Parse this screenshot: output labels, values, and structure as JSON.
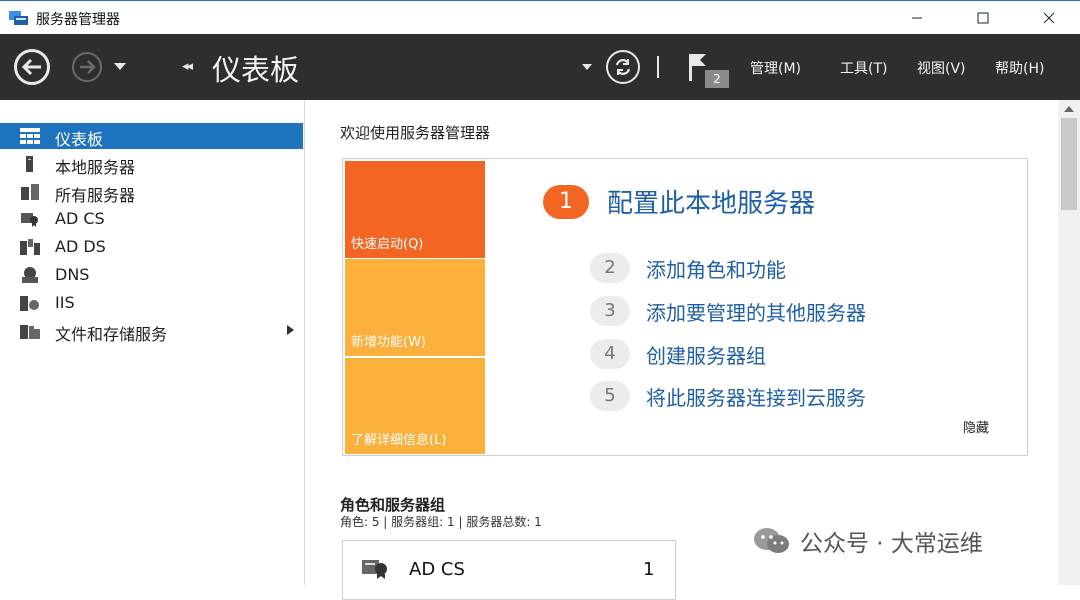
{
  "window": {
    "title": "服务器管理器"
  },
  "header": {
    "page_title": "仪表板",
    "notification_count": "2",
    "menus": [
      "管理(M)",
      "工具(T)",
      "视图(V)",
      "帮助(H)"
    ]
  },
  "sidebar": {
    "items": [
      {
        "label": "仪表板",
        "icon": "dashboard-icon",
        "active": true
      },
      {
        "label": "本地服务器",
        "icon": "server-icon"
      },
      {
        "label": "所有服务器",
        "icon": "servers-icon"
      },
      {
        "label": "AD CS",
        "icon": "certificate-icon"
      },
      {
        "label": "AD DS",
        "icon": "directory-icon"
      },
      {
        "label": "DNS",
        "icon": "dns-icon"
      },
      {
        "label": "IIS",
        "icon": "iis-icon"
      },
      {
        "label": "文件和存储服务",
        "icon": "storage-icon",
        "has_submenu": true
      }
    ]
  },
  "welcome": {
    "title": "欢迎使用服务器管理器",
    "tiles": [
      "快速启动(Q)",
      "新增功能(W)",
      "了解详细信息(L)"
    ],
    "steps": [
      {
        "num": "1",
        "label": "配置此本地服务器"
      },
      {
        "num": "2",
        "label": "添加角色和功能"
      },
      {
        "num": "3",
        "label": "添加要管理的其他服务器"
      },
      {
        "num": "4",
        "label": "创建服务器组"
      },
      {
        "num": "5",
        "label": "将此服务器连接到云服务"
      }
    ],
    "hide_label": "隐藏"
  },
  "roles": {
    "title": "角色和服务器组",
    "summary": "角色: 5 | 服务器组: 1 | 服务器总数: 1",
    "cards": [
      {
        "name": "AD CS",
        "count": "1"
      }
    ]
  },
  "watermark": {
    "text": "公众号 · 大常运维"
  },
  "colors": {
    "header_bg": "#2e2e2e",
    "accent": "#1e73be",
    "orange": "#f26522",
    "amber": "#fbb03b",
    "link": "#1f5fa6"
  }
}
